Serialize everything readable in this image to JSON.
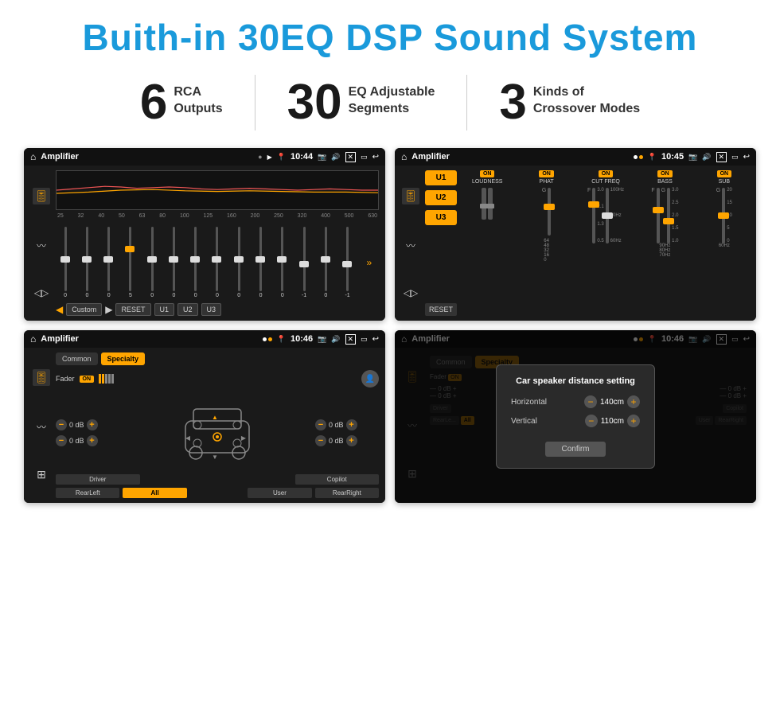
{
  "header": {
    "title": "Buith-in 30EQ DSP Sound System"
  },
  "stats": [
    {
      "number": "6",
      "text": "RCA\nOutputs"
    },
    {
      "number": "30",
      "text": "EQ Adjustable\nSegments"
    },
    {
      "number": "3",
      "text": "Kinds of\nCrossover Modes"
    }
  ],
  "screens": {
    "eq": {
      "title": "Amplifier",
      "time": "10:44",
      "freq_labels": [
        "25",
        "32",
        "40",
        "50",
        "63",
        "80",
        "100",
        "125",
        "160",
        "200",
        "250",
        "320",
        "400",
        "500",
        "630"
      ],
      "slider_values": [
        "0",
        "0",
        "0",
        "5",
        "0",
        "0",
        "0",
        "0",
        "0",
        "0",
        "0",
        "-1",
        "0",
        "-1"
      ],
      "bottom_buttons": [
        "Custom",
        "RESET",
        "U1",
        "U2",
        "U3"
      ]
    },
    "crossover": {
      "title": "Amplifier",
      "time": "10:45",
      "u_buttons": [
        "U1",
        "U2",
        "U3"
      ],
      "labels": [
        "LOUDNESS",
        "PHAT",
        "CUT FREQ",
        "BASS",
        "SUB"
      ],
      "reset_label": "RESET"
    },
    "speaker": {
      "title": "Amplifier",
      "time": "10:46",
      "tabs": [
        "Common",
        "Specialty"
      ],
      "fader_label": "Fader",
      "on_label": "ON",
      "left_db": [
        "0 dB",
        "0 dB"
      ],
      "right_db": [
        "0 dB",
        "0 dB"
      ],
      "bottom_buttons": [
        "Driver",
        "",
        "",
        "Copilot",
        "RearLeft",
        "All",
        "",
        "User",
        "RearRight"
      ]
    },
    "dialog": {
      "title": "Amplifier",
      "time": "10:46",
      "dialog_title": "Car speaker distance setting",
      "horizontal_label": "Horizontal",
      "horizontal_value": "140cm",
      "vertical_label": "Vertical",
      "vertical_value": "110cm",
      "confirm_label": "Confirm"
    }
  }
}
